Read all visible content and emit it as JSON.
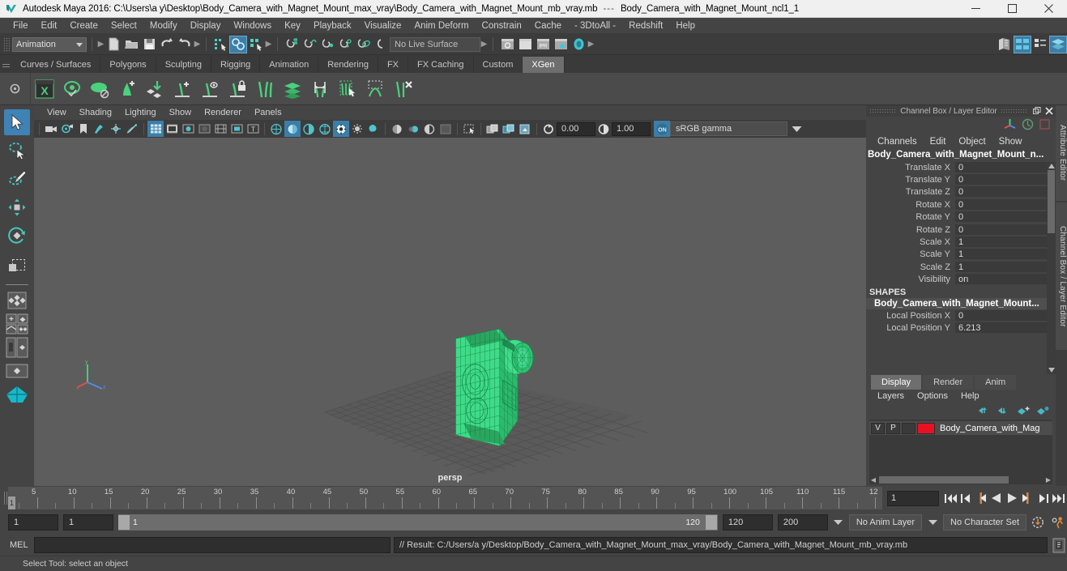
{
  "titlebar": {
    "app_title": "Autodesk Maya 2016: C:\\Users\\a y\\Desktop\\Body_Camera_with_Magnet_Mount_max_vray\\Body_Camera_with_Magnet_Mount_mb_vray.mb",
    "separator": "---",
    "object_title": "Body_Camera_with_Magnet_Mount_ncl1_1",
    "minimize_icon": "minimize-icon",
    "restore_icon": "restore-icon",
    "close_icon": "close-icon"
  },
  "menubar": {
    "items": [
      "File",
      "Edit",
      "Create",
      "Select",
      "Modify",
      "Display",
      "Windows",
      "Key",
      "Playback",
      "Visualize",
      "Anim Deform",
      "Constrain",
      "Cache",
      "- 3DtoAll -",
      "Redshift",
      "Help"
    ]
  },
  "statusline": {
    "menuset": "Animation",
    "live_surface": "No Live Surface",
    "file_icons": [
      "new-scene-icon",
      "open-scene-icon",
      "save-scene-icon",
      "undo-icon",
      "redo-icon"
    ],
    "select_mode_icons": [
      "select-by-hierarchy-icon",
      "select-by-object-icon",
      "select-by-component-icon"
    ],
    "snap_icons": [
      "snap-to-grid-icon",
      "snap-to-curve-icon",
      "snap-to-point-icon",
      "snap-to-projected-center-icon",
      "snap-to-view-plane-icon",
      "make-live-icon"
    ],
    "render_icons": [
      "render-current-frame-icon",
      "render-sequence-icon",
      "ipr-render-icon",
      "render-settings-icon",
      "hypershade-icon"
    ],
    "editor_icons": [
      "outliner-icon",
      "node-editor-icon",
      "attribute-editor-icon",
      "layer-editor-icon"
    ]
  },
  "shelf": {
    "tabs": [
      "Curves / Surfaces",
      "Polygons",
      "Sculpting",
      "Rigging",
      "Animation",
      "Rendering",
      "FX",
      "FX Caching",
      "Custom",
      "XGen"
    ],
    "active_tab": "XGen",
    "icons": [
      "xgen-editor-icon",
      "xgen-preview-icon",
      "xgen-disable-preview-icon",
      "xgen-add-description-icon",
      "xgen-import-collection-icon",
      "xgen-add-guide-icon",
      "xgen-select-guide-icon",
      "xgen-lock-guide-icon",
      "xgen-sculpt-guide-icon",
      "xgen-density-mask-icon",
      "xgen-groom-icon",
      "xgen-region-select-icon",
      "xgen-clump-icon",
      "xgen-delete-guide-icon"
    ]
  },
  "toolbox": {
    "tools": [
      "select-tool",
      "lasso-select-tool",
      "paint-select-tool",
      "move-tool",
      "rotate-tool",
      "scale-tool",
      "last-tool",
      "universal-manipulator",
      "layout-four-view",
      "layout-persp-outliner",
      "layout-single-perspective",
      "layout-hypershade"
    ],
    "active_tool": "select-tool"
  },
  "viewport": {
    "panel_menu": [
      "View",
      "Shading",
      "Lighting",
      "Show",
      "Renderer",
      "Panels"
    ],
    "camera_label": "persp",
    "exposure": "0.00",
    "gamma": "1.00",
    "color_management": "sRGB gamma",
    "cm_toggle": "ON",
    "wireframe_color": "#39f08d",
    "background_color": "#5d5d5d",
    "toolbar_icons": [
      "select-camera-icon",
      "lock-camera-icon",
      "bookmark-icon",
      "image-plane-icon",
      "2d-pan-zoom-icon",
      "grease-pencil-icon",
      "grid-toggle-icon",
      "film-gate-icon",
      "resolution-gate-icon",
      "gate-mask-icon",
      "field-chart-icon",
      "safe-action-icon",
      "safe-title-icon",
      "wireframe-shading-icon",
      "smooth-shading-icon",
      "smooth-shade-all-icon",
      "shaded-wireframe-icon",
      "textured-icon",
      "use-default-lighting-icon",
      "shadows-icon",
      "screen-space-ao-icon",
      "motion-blur-icon",
      "multisample-icon",
      "isolate-select-icon",
      "xray-icon",
      "xray-joints-icon",
      "xray-active-components-icon",
      "exposure-icon",
      "gamma-icon"
    ]
  },
  "channelbox": {
    "panel_title": "Channel Box / Layer Editor",
    "undock_icon": "undock-icon",
    "close_icon": "close-icon",
    "header_icons": [
      "channel-box-icon",
      "attribute-editor-icon",
      "modeling-toolkit-icon"
    ],
    "menus": [
      "Channels",
      "Edit",
      "Object",
      "Show"
    ],
    "object_name": "Body_Camera_with_Magnet_Mount_n...",
    "channels": [
      {
        "label": "Translate X",
        "value": "0"
      },
      {
        "label": "Translate Y",
        "value": "0"
      },
      {
        "label": "Translate Z",
        "value": "0"
      },
      {
        "label": "Rotate X",
        "value": "0"
      },
      {
        "label": "Rotate Y",
        "value": "0"
      },
      {
        "label": "Rotate Z",
        "value": "0"
      },
      {
        "label": "Scale X",
        "value": "1"
      },
      {
        "label": "Scale Y",
        "value": "1"
      },
      {
        "label": "Scale Z",
        "value": "1"
      },
      {
        "label": "Visibility",
        "value": "on"
      }
    ],
    "shapes_header": "SHAPES",
    "shape_name": "Body_Camera_with_Magnet_Mount...",
    "shape_channels": [
      {
        "label": "Local Position X",
        "value": "0"
      },
      {
        "label": "Local Position Y",
        "value": "6.213"
      }
    ]
  },
  "layereditor": {
    "tabs": [
      "Display",
      "Render",
      "Anim"
    ],
    "active_tab": "Display",
    "menus": [
      "Layers",
      "Options",
      "Help"
    ],
    "buttons": [
      "move-layer-up-icon",
      "move-layer-down-icon",
      "new-layer-icon",
      "new-layer-from-selected-icon"
    ],
    "layers": [
      {
        "visibility": "V",
        "playback": "P",
        "type": "",
        "color": "#e81123",
        "name": "Body_Camera_with_Mag"
      }
    ]
  },
  "docktabs": {
    "items": [
      "Attribute Editor",
      "Channel Box / Layer Editor"
    ]
  },
  "timeslider": {
    "current_frame": "1",
    "start": 1,
    "end": 120,
    "tick_labels": [
      "5",
      "10",
      "15",
      "20",
      "25",
      "30",
      "35",
      "40",
      "45",
      "50",
      "55",
      "60",
      "65",
      "70",
      "75",
      "80",
      "85",
      "90",
      "95",
      "100",
      "105",
      "110",
      "115",
      "12"
    ],
    "frame_field": "1",
    "playback_buttons": [
      "go-to-start-icon",
      "step-back-frame-icon",
      "step-back-key-icon",
      "play-backwards-icon",
      "play-forwards-icon",
      "step-forward-key-icon",
      "step-forward-frame-icon",
      "go-to-end-icon"
    ]
  },
  "rangeslider": {
    "anim_start": "1",
    "playback_start": "1",
    "range_low": "1",
    "range_high": "120",
    "playback_end": "120",
    "anim_end": "200",
    "anim_layer": "No Anim Layer",
    "character_set": "No Character Set",
    "auto_key_icon": "auto-keyframe-icon",
    "anim_prefs_icon": "animation-preferences-icon"
  },
  "commandline": {
    "mel_label": "MEL",
    "input_value": "",
    "result": "// Result: C:/Users/a y/Desktop/Body_Camera_with_Magnet_Mount_max_vray/Body_Camera_with_Magnet_Mount_mb_vray.mb",
    "script_editor_icon": "script-editor-icon"
  },
  "helpline": {
    "text": "Select Tool: select an object"
  }
}
